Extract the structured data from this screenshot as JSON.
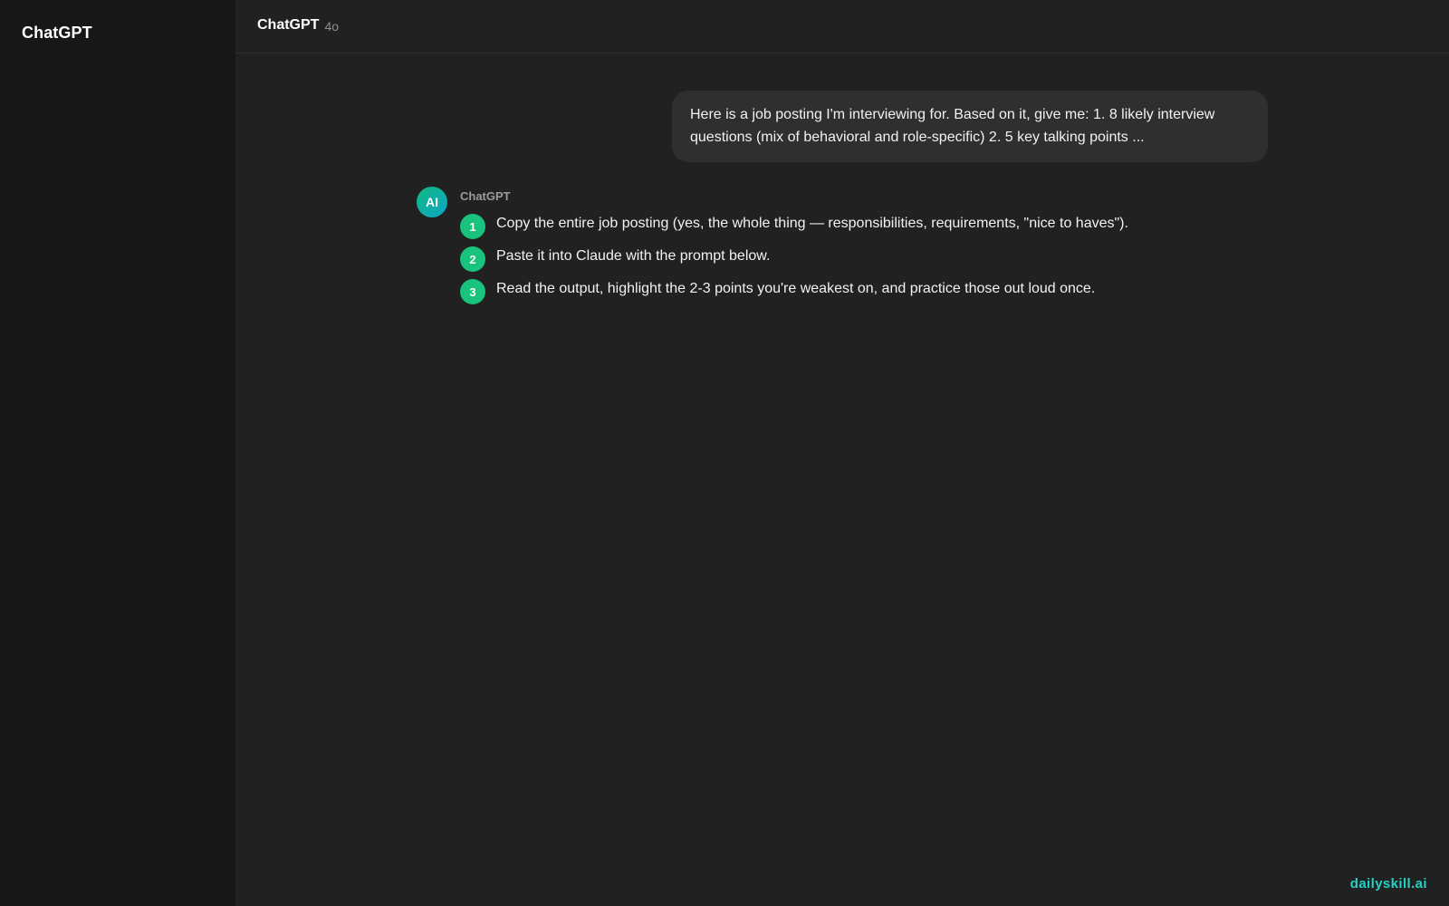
{
  "sidebar": {
    "brand": "ChatGPT"
  },
  "header": {
    "model_name": "ChatGPT",
    "model_version": "4o"
  },
  "conversation": {
    "user_message": "Here is a job posting I'm interviewing for. Based on it, give me: 1. 8 likely interview questions (mix of behavioral and role-specific) 2. 5 key talking points ...",
    "assistant": {
      "avatar_label": "AI",
      "name": "ChatGPT",
      "steps": [
        {
          "number": "1",
          "text": "Copy the entire job posting (yes, the whole thing — responsibilities, requirements, \"nice to haves\")."
        },
        {
          "number": "2",
          "text": "Paste it into Claude with the prompt below."
        },
        {
          "number": "3",
          "text": "Read the output, highlight the 2-3 points you're weakest on, and practice those out loud once."
        }
      ]
    }
  },
  "watermark": "dailyskill.ai",
  "colors": {
    "sidebar_bg": "#171717",
    "main_bg": "#212121",
    "bubble_bg": "#2f2f2f",
    "step_badge": "#19c37d",
    "watermark": "#22d3c5"
  }
}
